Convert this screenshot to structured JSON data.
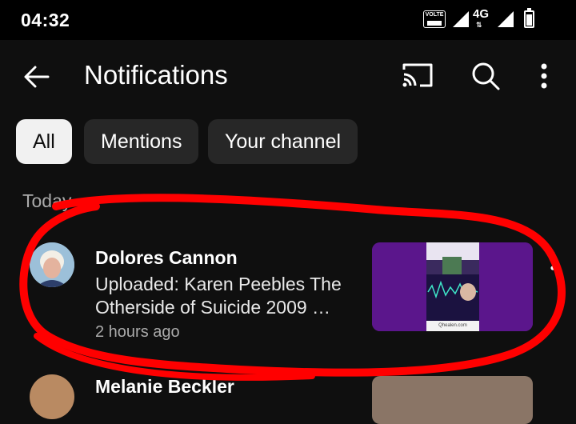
{
  "status": {
    "time": "04:32",
    "volte": "VOLTE",
    "network": "4G"
  },
  "header": {
    "title": "Notifications"
  },
  "filters": [
    {
      "label": "All",
      "active": true
    },
    {
      "label": "Mentions",
      "active": false
    },
    {
      "label": "Your channel",
      "active": false
    }
  ],
  "sections": {
    "today": "Today"
  },
  "notifications": [
    {
      "channel": "Dolores Cannon",
      "text": "Uploaded: Karen Peebles The Otherside of Suicide   2009   …",
      "time": "2 hours ago",
      "thumbnail_footer": "Qhealen.com"
    },
    {
      "channel": "Melanie Beckler"
    }
  ],
  "colors": {
    "background": "#0f0f0f",
    "chip": "#272727",
    "chip_active": "#f1f1f1",
    "annotation": "#ff0000"
  }
}
